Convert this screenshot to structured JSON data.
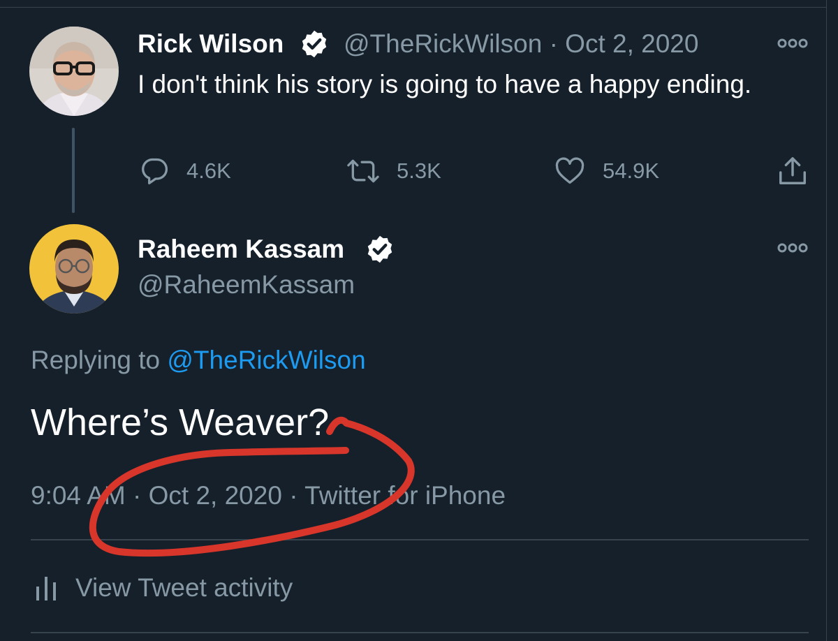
{
  "colors": {
    "background": "#15202b",
    "text_primary": "#ffffff",
    "text_secondary": "#8899a6",
    "link": "#1d9bf0",
    "divider": "#38444d",
    "annotation": "#d8362a"
  },
  "parent_tweet": {
    "author_name": "Rick Wilson",
    "verified_icon": "verified-badge-icon",
    "handle": "@TheRickWilson",
    "separator": "·",
    "date": "Oct 2, 2020",
    "more_icon": "more-options-icon",
    "text": "I don't think his story is going to have a happy ending.",
    "actions": {
      "reply_icon": "reply-icon",
      "reply_count": "4.6K",
      "retweet_icon": "retweet-icon",
      "retweet_count": "5.3K",
      "like_icon": "like-icon",
      "like_count": "54.9K",
      "share_icon": "share-icon"
    }
  },
  "main_tweet": {
    "author_name": "Raheem Kassam",
    "verified_icon": "verified-badge-icon",
    "handle": "@RaheemKassam",
    "more_icon": "more-options-icon",
    "replying_prefix": "Replying to",
    "replying_handle": "@TheRickWilson",
    "text": "Where’s Weaver?",
    "meta": "9:04 AM · Oct 2, 2020 · Twitter for iPhone"
  },
  "activity": {
    "icon": "analytics-icon",
    "label": "View Tweet activity"
  }
}
